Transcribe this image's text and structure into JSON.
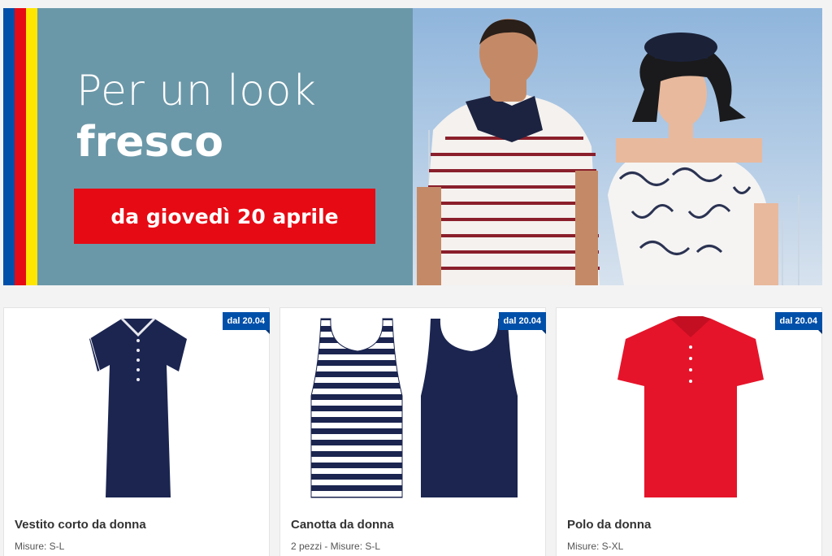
{
  "banner": {
    "headline_line1": "Per un look",
    "headline_line2": "fresco",
    "cta": "da giovedì 20 aprile",
    "colors": {
      "blue": "#0050aa",
      "red": "#e60a14",
      "yellow": "#ffe500",
      "panel": "#6b98a8"
    }
  },
  "products": [
    {
      "badge": "dal 20.04",
      "title": "Vestito corto da donna",
      "subtitle": "Misure: S-L",
      "image": "navy-polo-dress"
    },
    {
      "badge": "dal 20.04",
      "title": "Canotta da donna",
      "subtitle": "2 pezzi - Misure: S-L",
      "image": "striped-and-navy-tank-tops"
    },
    {
      "badge": "dal 20.04",
      "title": "Polo da donna",
      "subtitle": "Misure: S-XL",
      "image": "red-polo-shirt"
    }
  ]
}
